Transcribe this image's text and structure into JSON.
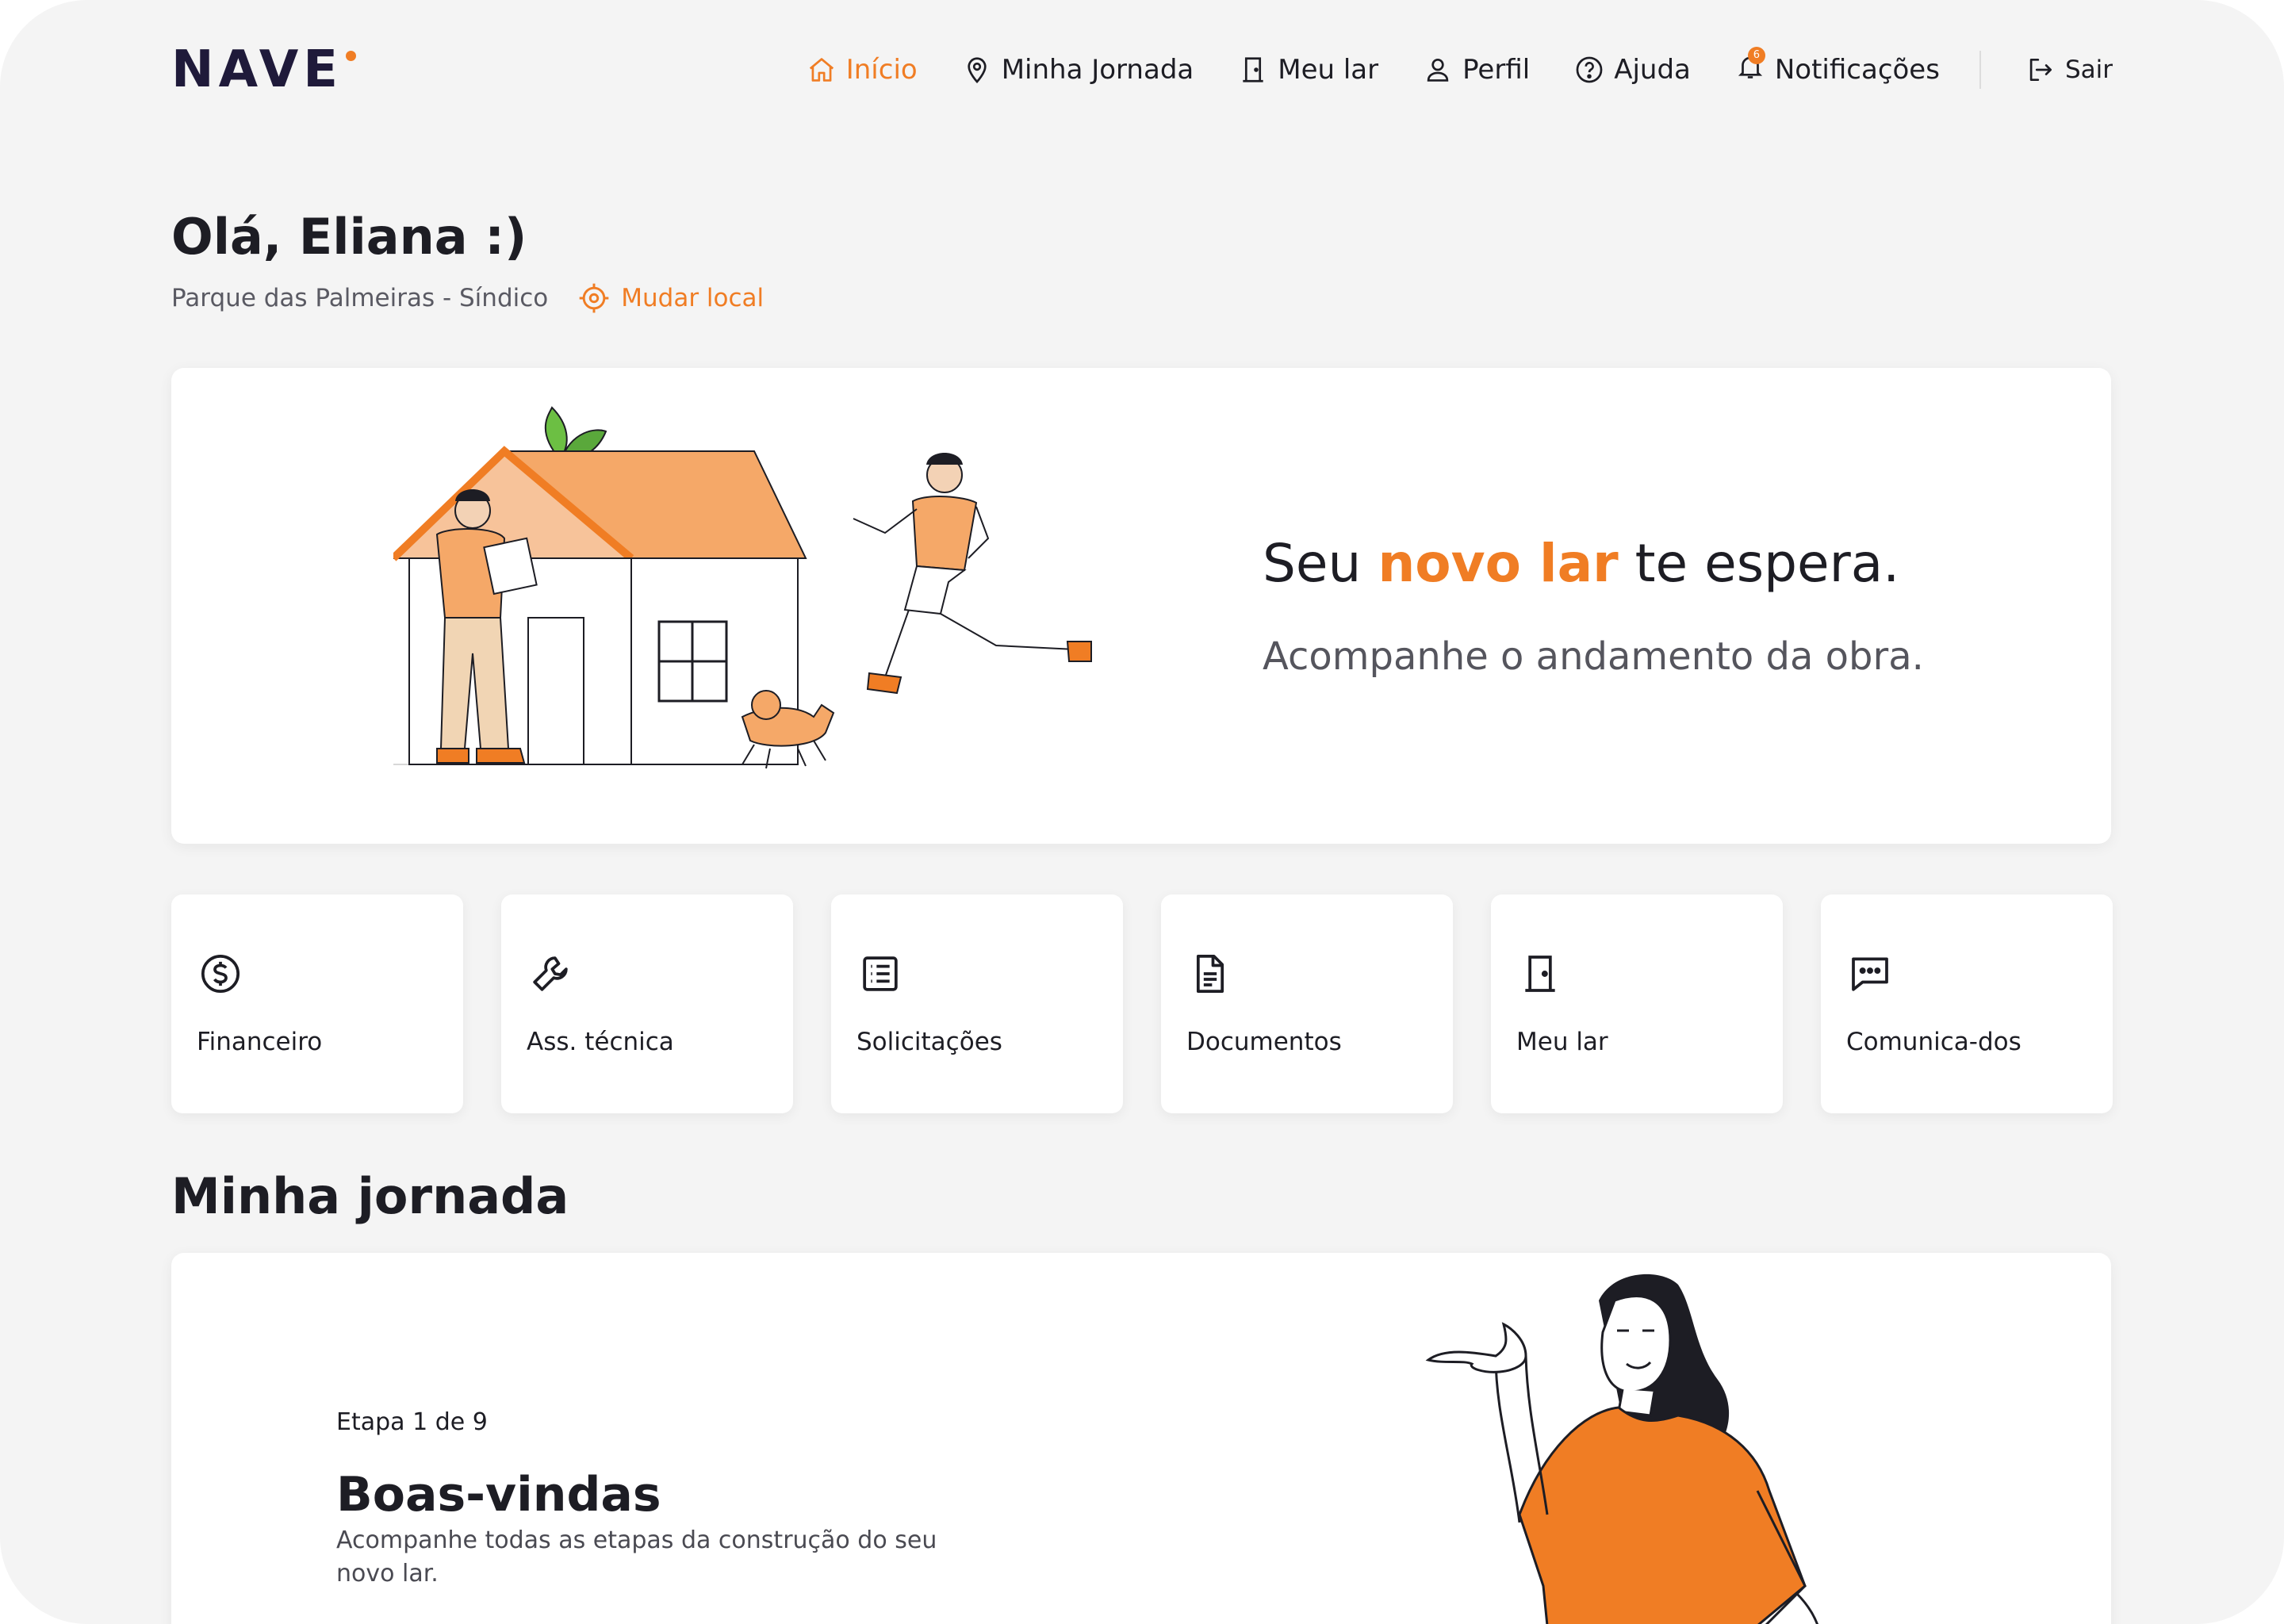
{
  "app": {
    "logo_text": "NAVE"
  },
  "nav": {
    "items": [
      {
        "label": "Início",
        "icon": "home-icon",
        "active": true
      },
      {
        "label": "Minha Jornada",
        "icon": "map-pin-icon"
      },
      {
        "label": "Meu lar",
        "icon": "door-icon"
      },
      {
        "label": "Perfil",
        "icon": "user-icon"
      },
      {
        "label": "Ajuda",
        "icon": "help-icon"
      },
      {
        "label": "Notificações",
        "icon": "bell-icon",
        "badge": "6"
      }
    ],
    "logout_label": "Sair"
  },
  "greeting": {
    "title": "Olá, Eliana :)",
    "location": "Parque das Palmeiras - Síndico",
    "change_location": "Mudar local"
  },
  "hero": {
    "title_before": "Seu ",
    "title_accent": "novo lar",
    "title_after": " te espera.",
    "subtitle": "Acompanhe o andamento da obra."
  },
  "tiles": [
    {
      "label": "Financeiro",
      "icon": "dollar-icon"
    },
    {
      "label": "Ass. técnica",
      "icon": "wrench-icon"
    },
    {
      "label": "Solicitações",
      "icon": "list-icon"
    },
    {
      "label": "Documentos",
      "icon": "document-icon"
    },
    {
      "label": "Meu lar",
      "icon": "door-icon"
    },
    {
      "label": "Comunica-dos",
      "icon": "chat-icon"
    }
  ],
  "journey": {
    "section_title": "Minha jornada",
    "step": "Etapa 1 de 9",
    "title": "Boas-vindas",
    "description": "Acompanhe todas as etapas da construção do seu novo lar."
  },
  "colors": {
    "accent": "#f07d24",
    "text": "#1d1d24",
    "background": "#f4f4f4"
  }
}
